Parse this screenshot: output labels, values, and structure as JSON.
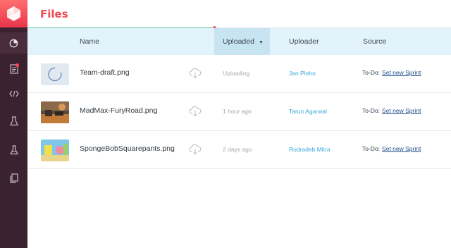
{
  "page": {
    "title": "Files"
  },
  "nav": [
    {
      "name": "dashboard-icon",
      "active": true
    },
    {
      "name": "document-icon",
      "badge": true
    },
    {
      "name": "code-icon"
    },
    {
      "name": "flask-icon"
    },
    {
      "name": "beaker-icon"
    },
    {
      "name": "pages-icon"
    }
  ],
  "table": {
    "headers": {
      "name": "Name",
      "uploaded": "Uploaded",
      "uploader": "Uploader",
      "source": "Source"
    },
    "rows": [
      {
        "thumbnail": "spinner",
        "filename": "Team-draft.png",
        "uploaded": "Uploading",
        "uploader": "Jan Pleho",
        "source_prefix": "To-Do:",
        "source_link": "Set new Sprint"
      },
      {
        "thumbnail": "desert-image",
        "filename": "MadMax-FuryRoad.png",
        "uploaded": "1 hour ago",
        "uploader": "Tarun Agarwal",
        "source_prefix": "To-Do:",
        "source_link": "Set new Sprint"
      },
      {
        "thumbnail": "cartoon-image",
        "filename": "SpongeBobSquarepants.png",
        "uploaded": "2 days ago",
        "uploader": "Rudradeb Mitra",
        "source_prefix": "To-Do:",
        "source_link": "Set new Sprint"
      }
    ]
  },
  "colors": {
    "accent": "#ef4a55",
    "sidebar": "#3b2230",
    "header_bg": "#e3f3fb",
    "link": "#3aa8dc"
  }
}
